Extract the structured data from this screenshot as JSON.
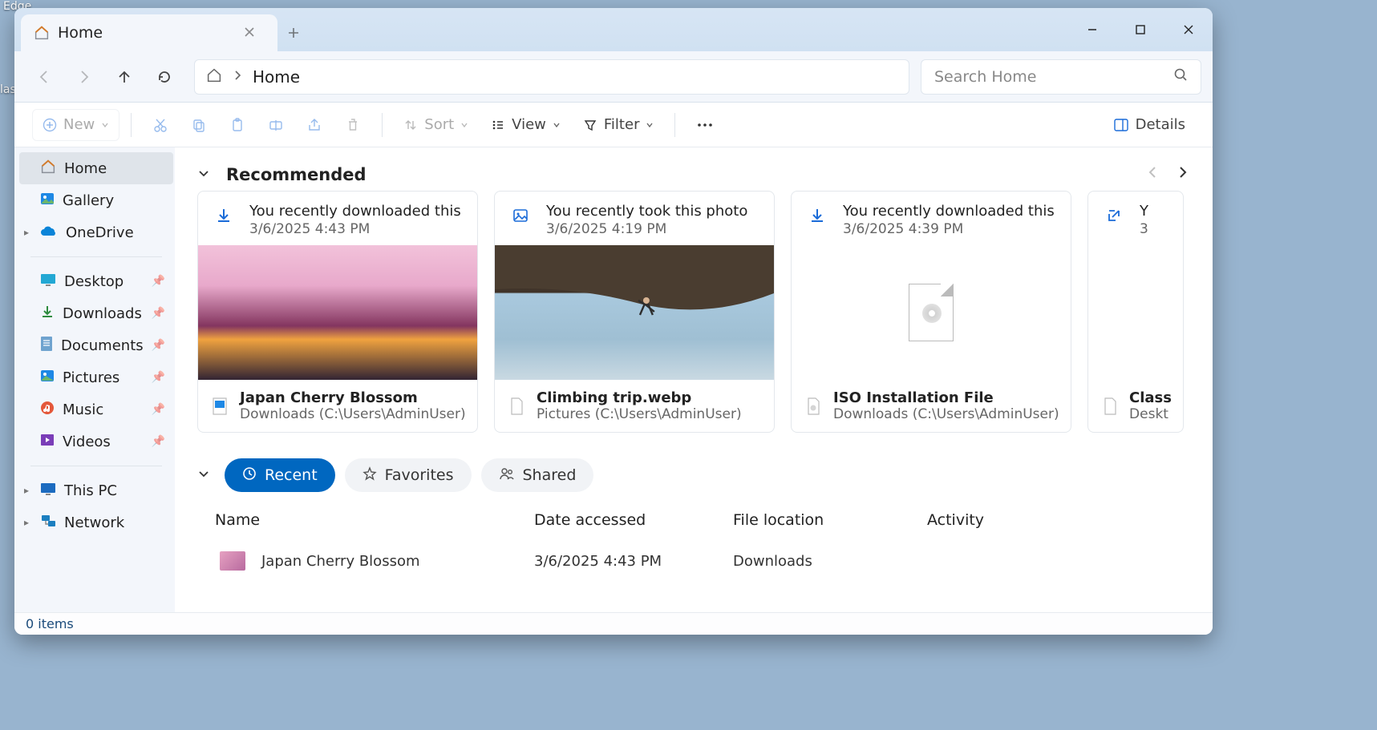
{
  "desktop": {
    "shortcut1": "Edge",
    "shortcut2": "las"
  },
  "tab": {
    "title": "Home"
  },
  "address": {
    "location": "Home"
  },
  "search": {
    "placeholder": "Search Home"
  },
  "toolbar": {
    "new": "New",
    "sort": "Sort",
    "view": "View",
    "filter": "Filter",
    "details": "Details"
  },
  "sidebar": {
    "home": "Home",
    "gallery": "Gallery",
    "onedrive": "OneDrive",
    "desktop": "Desktop",
    "downloads": "Downloads",
    "documents": "Documents",
    "pictures": "Pictures",
    "music": "Music",
    "videos": "Videos",
    "thispc": "This PC",
    "network": "Network"
  },
  "recommended": {
    "title": "Recommended",
    "cards": [
      {
        "reason": "You recently downloaded this",
        "date": "3/6/2025 4:43 PM",
        "name": "Japan Cherry Blossom",
        "path": "Downloads (C:\\Users\\AdminUser)"
      },
      {
        "reason": "You recently took this photo",
        "date": "3/6/2025 4:19 PM",
        "name": "Climbing trip.webp",
        "path": "Pictures (C:\\Users\\AdminUser)"
      },
      {
        "reason": "You recently downloaded this",
        "date": "3/6/2025 4:39 PM",
        "name": "ISO Installation File",
        "path": "Downloads (C:\\Users\\AdminUser)"
      },
      {
        "reason": "Y",
        "date": "3",
        "name": "Class",
        "path": "Deskt"
      }
    ]
  },
  "chips": {
    "recent": "Recent",
    "favorites": "Favorites",
    "shared": "Shared"
  },
  "table": {
    "cols": {
      "name": "Name",
      "date": "Date accessed",
      "loc": "File location",
      "act": "Activity"
    },
    "rows": [
      {
        "name": "Japan Cherry Blossom",
        "date": "3/6/2025 4:43 PM",
        "loc": "Downloads",
        "act": ""
      }
    ]
  },
  "status": {
    "items": "0 items"
  }
}
